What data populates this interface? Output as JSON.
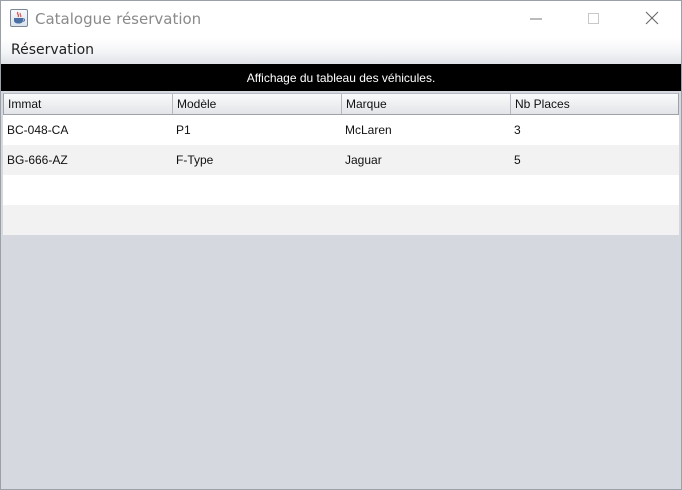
{
  "window": {
    "title": "Catalogue réservation",
    "icon": "java-coffee-cup-icon",
    "controls": [
      "minimize-icon",
      "maximize-icon",
      "close-icon"
    ]
  },
  "menubar": {
    "items": [
      {
        "label": "Réservation"
      }
    ]
  },
  "banner": {
    "text": "Affichage du tableau des véhicules."
  },
  "table": {
    "columns": [
      "Immat",
      "Modèle",
      "Marque",
      "Nb Places"
    ],
    "rows": [
      [
        "BC-048-CA",
        "P1",
        "McLaren",
        "3"
      ],
      [
        "BG-666-AZ",
        "F-Type",
        "Jaguar",
        "5"
      ],
      [
        "",
        "",
        "",
        ""
      ],
      [
        "",
        "",
        "",
        ""
      ]
    ]
  },
  "colors": {
    "banner_bg": "#000000",
    "banner_text": "#ffffff",
    "empty_area": "#d5d8df",
    "row_alt": "#f2f2f2"
  }
}
